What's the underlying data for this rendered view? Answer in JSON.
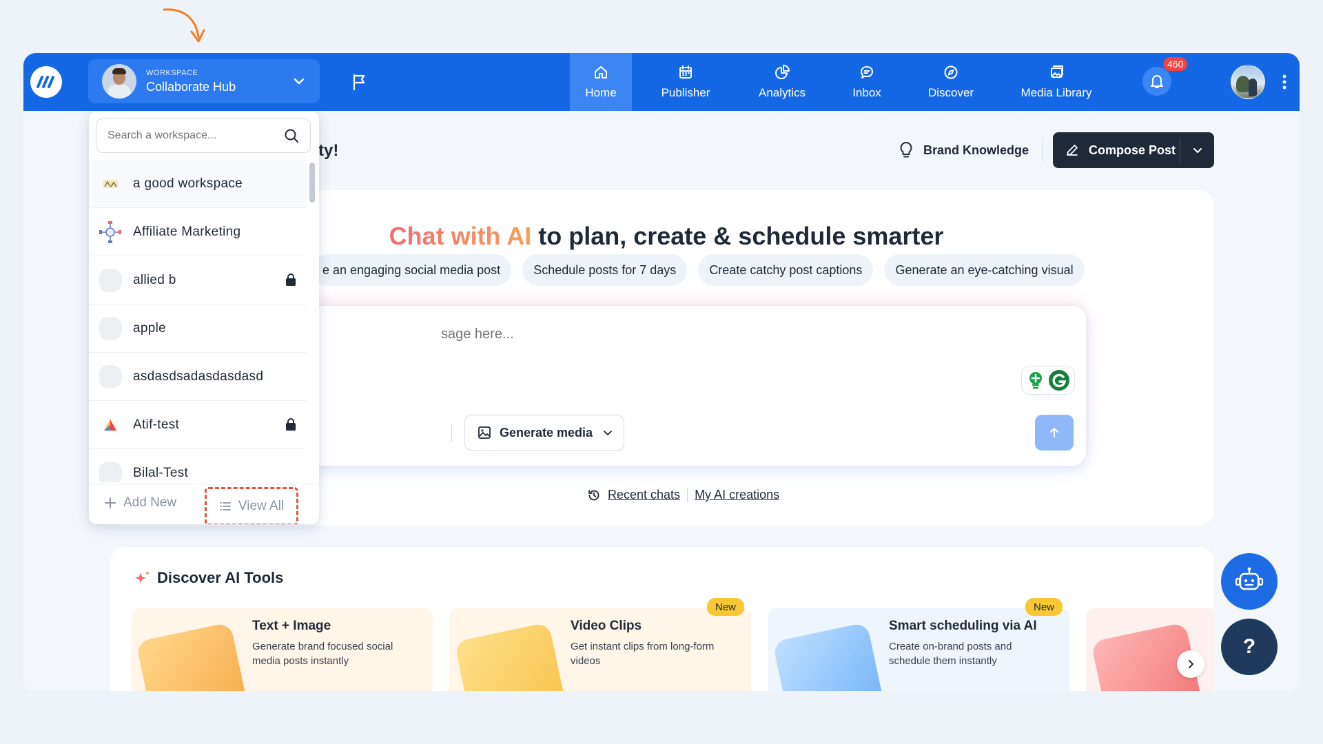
{
  "nav": {
    "workspace_label": "WORKSPACE",
    "workspace_name": "Collaborate Hub",
    "items": [
      {
        "label": "Home",
        "icon": "home-icon",
        "active": true
      },
      {
        "label": "Publisher",
        "icon": "calendar-icon",
        "active": false
      },
      {
        "label": "Analytics",
        "icon": "pie-chart-icon",
        "active": false
      },
      {
        "label": "Inbox",
        "icon": "chat-bubble-icon",
        "active": false
      },
      {
        "label": "Discover",
        "icon": "compass-icon",
        "active": false
      },
      {
        "label": "Media Library",
        "icon": "image-gallery-icon",
        "active": false
      }
    ],
    "notification_count": "460"
  },
  "header": {
    "title_fragment": "ty!",
    "brand_knowledge": "Brand Knowledge",
    "compose_post": "Compose Post"
  },
  "ai_chat": {
    "headline_highlight": "Chat with AI",
    "headline_rest": " to plan, create & schedule smarter",
    "chips": [
      "e an engaging social media post",
      "Schedule posts for 7 days",
      "Create catchy post captions",
      "Generate an eye-catching visual"
    ],
    "input_placeholder": "sage here...",
    "generate_media": "Generate media",
    "recent_chats": "Recent chats",
    "my_ai_creations": "My AI creations"
  },
  "discover": {
    "title": "Discover AI Tools",
    "tools": [
      {
        "title": "Text + Image",
        "description": "Generate brand focused social media posts instantly",
        "badge": ""
      },
      {
        "title": "Video Clips",
        "description": "Get instant clips from long-form videos",
        "badge": "New"
      },
      {
        "title": "Smart scheduling via AI",
        "description": "Create on-brand posts and schedule them instantly",
        "badge": "New"
      }
    ]
  },
  "workspace_dropdown": {
    "search_placeholder": "Search a workspace...",
    "items": [
      {
        "name": "a good workspace",
        "locked": false
      },
      {
        "name": "Affiliate Marketing",
        "locked": false
      },
      {
        "name": "allied b",
        "locked": true
      },
      {
        "name": "apple",
        "locked": false
      },
      {
        "name": "asdasdsadasdasdasd",
        "locked": false
      },
      {
        "name": "Atif-test",
        "locked": true
      },
      {
        "name": "Bilal-Test",
        "locked": false
      }
    ],
    "add_new": "Add New",
    "view_all": "View All"
  },
  "help_label": "?",
  "colors": {
    "nav_blue": "#1468e5",
    "highlight_dashed": "#e8533d",
    "annotation_arrow": "#f47b20",
    "new_badge": "#f7c734"
  }
}
